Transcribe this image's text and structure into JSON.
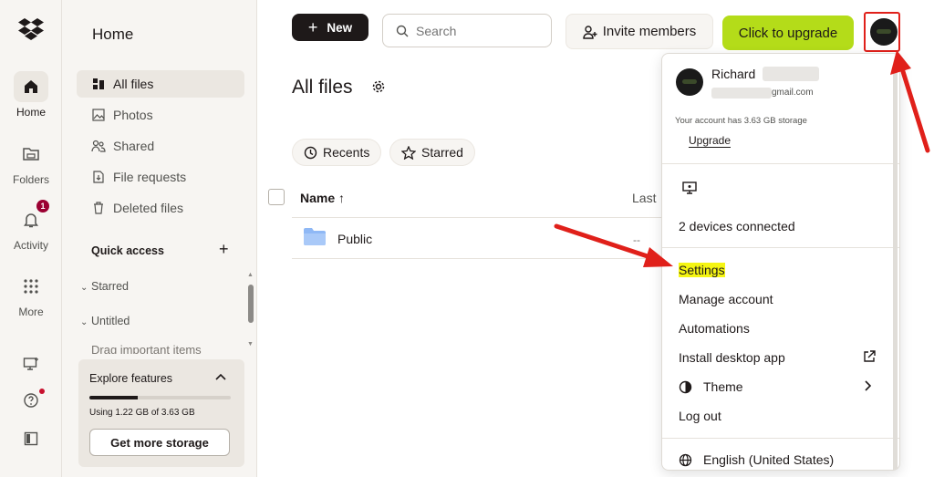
{
  "rail": {
    "items": [
      {
        "label": "Home",
        "icon": "home-icon"
      },
      {
        "label": "Folders",
        "icon": "folder-icon"
      },
      {
        "label": "Activity",
        "icon": "bell-icon",
        "badge": "1"
      },
      {
        "label": "More",
        "icon": "grid-icon"
      }
    ]
  },
  "sidebar": {
    "title": "Home",
    "items": [
      {
        "label": "All files",
        "icon": "files-icon"
      },
      {
        "label": "Photos",
        "icon": "photo-icon"
      },
      {
        "label": "Shared",
        "icon": "shared-icon"
      },
      {
        "label": "File requests",
        "icon": "file-request-icon"
      },
      {
        "label": "Deleted files",
        "icon": "trash-icon"
      }
    ],
    "quick_access": "Quick access",
    "folds": [
      "Starred",
      "Untitled"
    ],
    "drag_text": "Drag important items",
    "explore": {
      "title": "Explore features",
      "usage": "Using 1.22 GB of 3.63 GB",
      "usage_fraction": 0.34,
      "button": "Get more storage"
    }
  },
  "toolbar": {
    "new_label": "New",
    "search_placeholder": "Search",
    "invite_label": "Invite members",
    "upgrade_label": "Click to upgrade"
  },
  "main": {
    "title": "All files",
    "chips": [
      "Recents",
      "Starred"
    ],
    "columns": {
      "name": "Name",
      "name_sort": "↑",
      "last": "Last"
    },
    "rows": [
      {
        "name": "Public",
        "modified": "--"
      }
    ]
  },
  "menu": {
    "name": "Richard",
    "email": "gmail.com",
    "storage": "Your account has 3.63 GB storage",
    "upgrade": "Upgrade",
    "devices": "2 devices connected",
    "items": [
      "Settings",
      "Manage account",
      "Automations",
      "Install desktop app",
      "Theme",
      "Log out"
    ],
    "language": "English (United States)"
  },
  "colors": {
    "accent_upgrade": "#b4dc19",
    "highlight": "#f5f513",
    "annotation_red": "#e0201a"
  }
}
